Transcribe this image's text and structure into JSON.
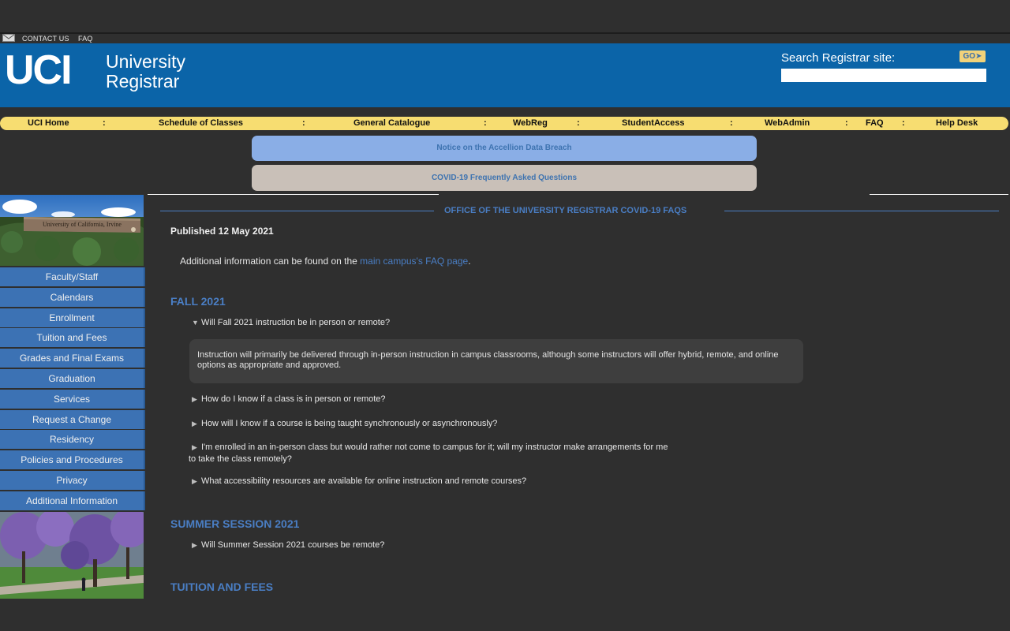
{
  "utility": {
    "contact": "CONTACT US",
    "faq": "FAQ"
  },
  "header": {
    "logo_text": "UCI",
    "logo_line1": "University",
    "logo_line2": "Registrar",
    "search_label": "Search Registrar site:",
    "search_placeholder": "",
    "go_label": "GO"
  },
  "nav": {
    "items": [
      "UCI Home",
      "Schedule of Classes",
      "General Catalogue",
      "WebReg",
      "StudentAccess",
      "WebAdmin",
      "FAQ",
      "Help Desk"
    ],
    "separator": ":"
  },
  "notices": {
    "accellion": "Notice on the Accellion Data Breach",
    "covid": "COVID-19 Frequently Asked Questions"
  },
  "sidebar": {
    "campus_sign_text": "University of California, Irvine",
    "items": [
      "Faculty/Staff",
      "Calendars",
      "Enrollment",
      "Tuition and Fees",
      "Grades and Final Exams",
      "Graduation",
      "Services",
      "Request a Change",
      "Residency",
      "Policies and Procedures",
      "Privacy",
      "Additional Information"
    ]
  },
  "main": {
    "section_title": "OFFICE OF THE UNIVERSITY REGISTRAR COVID-19 FAQS",
    "published": "Published 12 May 2021",
    "addinfo_prefix": "Additional information can be found on the ",
    "addinfo_link": "main campus's FAQ page",
    "addinfo_suffix": ".",
    "fall_heading": "FALL 2021",
    "fall_q1": "Will Fall 2021 instruction be in person or remote?",
    "fall_a1": "Instruction will primarily be delivered through in-person instruction in campus classrooms, although some instructors will offer hybrid, remote, and online options as appropriate and approved.",
    "fall_q2": "How do I know if a class is in person or remote?",
    "fall_q3": "How will I know if a course is being taught synchronously or asynchronously?",
    "fall_q4_line1": "I'm enrolled in an in-person class but would rather not come to campus for it; will my instructor make arrangements for me",
    "fall_q4_line2": "to take the class remotely?",
    "fall_q5": "What accessibility resources are available for online instruction and remote courses?",
    "summer_heading": "SUMMER SESSION 2021",
    "summer_q1": "Will Summer Session 2021 courses be remote?",
    "tuition_heading": "TUITION AND FEES"
  },
  "colors": {
    "banner": "#0b64a8",
    "navbar": "#f7dd71",
    "accent_blue": "#4a7ec4",
    "sidebar_item": "#3c72b4",
    "page_bg": "#2f2f2f"
  }
}
